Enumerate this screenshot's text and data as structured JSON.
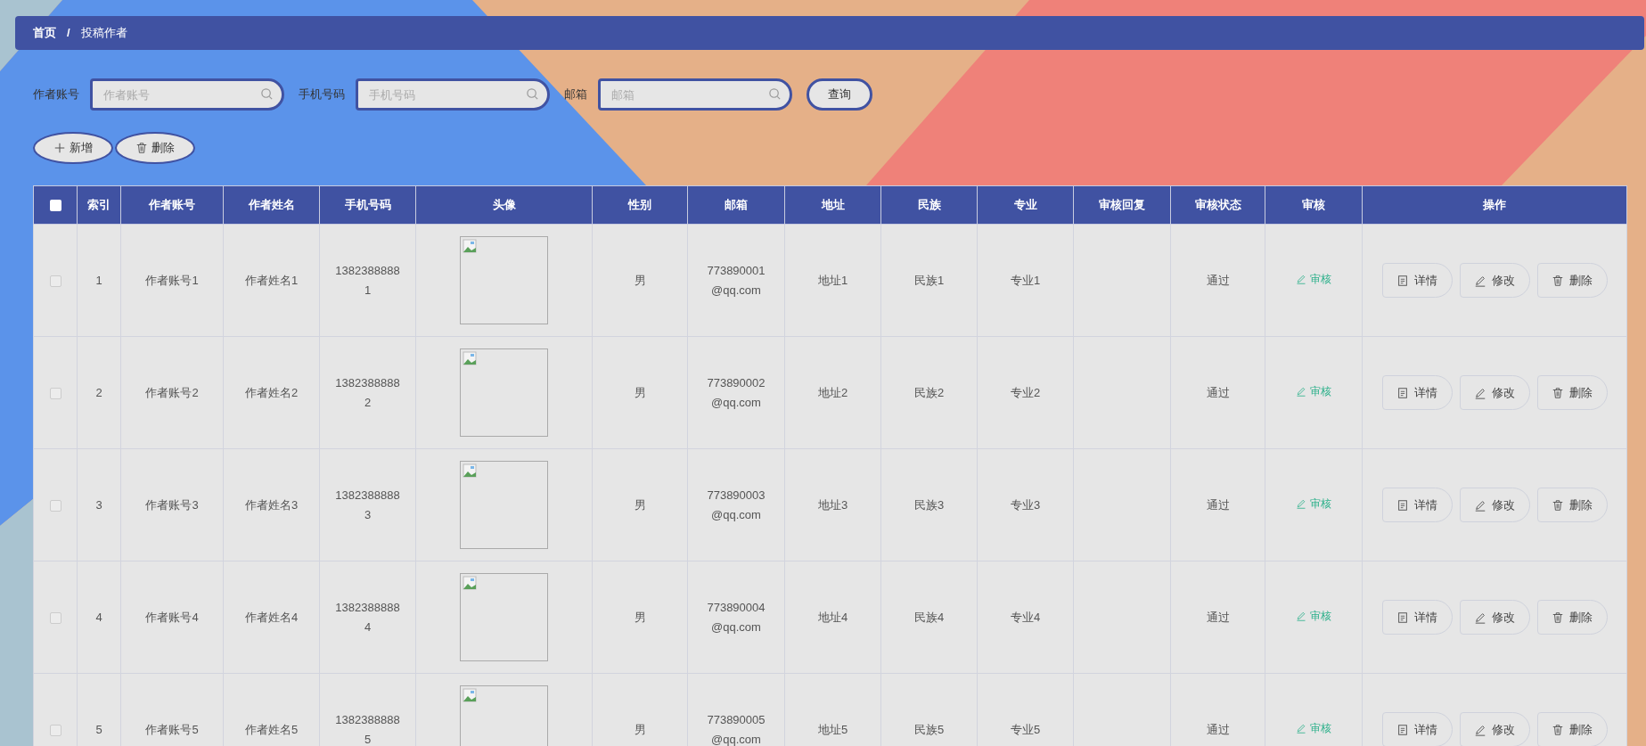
{
  "breadcrumb": {
    "items": [
      "首页",
      "投稿作者"
    ],
    "separator": "/"
  },
  "search": [
    {
      "label": "作者账号",
      "placeholder": "作者账号"
    },
    {
      "label": "手机号码",
      "placeholder": "手机号码"
    },
    {
      "label": "邮箱",
      "placeholder": "邮箱"
    }
  ],
  "search_button": "查询",
  "toolbar": [
    {
      "kind": "add",
      "label": "新增"
    },
    {
      "kind": "delete",
      "label": "删除"
    }
  ],
  "table": {
    "header_checked": false,
    "columns": [
      "索引",
      "作者账号",
      "作者姓名",
      "手机号码",
      "头像",
      "性别",
      "邮箱",
      "地址",
      "民族",
      "专业",
      "审核回复",
      "审核状态",
      "审核",
      "操作"
    ],
    "rows": [
      {
        "checked": false,
        "index": "1",
        "account": "作者账号1",
        "name": "作者姓名1",
        "phone": "13823888881",
        "gender": "男",
        "email": "773890001@qq.com",
        "address": "地址1",
        "ethnicity": "民族1",
        "major": "专业1",
        "status": "通过",
        "review": "审核",
        "actions": [
          {
            "kind": "detail",
            "label": "详情"
          },
          {
            "kind": "edit",
            "label": "修改"
          },
          {
            "kind": "delete",
            "label": "删除"
          }
        ]
      },
      {
        "checked": false,
        "index": "2",
        "account": "作者账号2",
        "name": "作者姓名2",
        "phone": "13823888882",
        "gender": "男",
        "email": "773890002@qq.com",
        "address": "地址2",
        "ethnicity": "民族2",
        "major": "专业2",
        "status": "通过",
        "review": "审核",
        "actions": [
          {
            "kind": "detail",
            "label": "详情"
          },
          {
            "kind": "edit",
            "label": "修改"
          },
          {
            "kind": "delete",
            "label": "删除"
          }
        ]
      },
      {
        "checked": false,
        "index": "3",
        "account": "作者账号3",
        "name": "作者姓名3",
        "phone": "13823888883",
        "gender": "男",
        "email": "773890003@qq.com",
        "address": "地址3",
        "ethnicity": "民族3",
        "major": "专业3",
        "status": "通过",
        "review": "审核",
        "actions": [
          {
            "kind": "detail",
            "label": "详情"
          },
          {
            "kind": "edit",
            "label": "修改"
          },
          {
            "kind": "delete",
            "label": "删除"
          }
        ]
      },
      {
        "checked": false,
        "index": "4",
        "account": "作者账号4",
        "name": "作者姓名4",
        "phone": "13823888884",
        "gender": "男",
        "email": "773890004@qq.com",
        "address": "地址4",
        "ethnicity": "民族4",
        "major": "专业4",
        "status": "通过",
        "review": "审核",
        "actions": [
          {
            "kind": "detail",
            "label": "详情"
          },
          {
            "kind": "edit",
            "label": "修改"
          },
          {
            "kind": "delete",
            "label": "删除"
          }
        ]
      },
      {
        "checked": false,
        "index": "5",
        "account": "作者账号5",
        "name": "作者姓名5",
        "phone": "13823888885",
        "gender": "男",
        "email": "773890005@qq.com",
        "address": "地址5",
        "ethnicity": "民族5",
        "major": "专业5",
        "status": "通过",
        "review": "审核",
        "actions": [
          {
            "kind": "detail",
            "label": "详情"
          },
          {
            "kind": "edit",
            "label": "修改"
          },
          {
            "kind": "delete",
            "label": "删除"
          }
        ]
      }
    ]
  }
}
